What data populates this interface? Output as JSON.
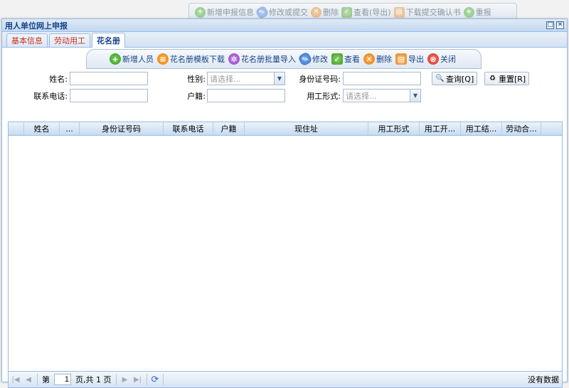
{
  "bg_toolbar": {
    "items": [
      "新增申报信息",
      "修改或提交",
      "删除",
      "查看(导出)",
      "下载提交确认书",
      "重报"
    ]
  },
  "window": {
    "title": "用人单位网上申报"
  },
  "tabs": [
    "基本信息",
    "劳动用工",
    "花名册"
  ],
  "toolbar": {
    "add": "新增人员",
    "template": "花名册模板下载",
    "import": "花名册批量导入",
    "edit": "修改",
    "view": "查看",
    "delete": "删除",
    "export": "导出",
    "close": "关闭"
  },
  "search": {
    "name_label": "姓名:",
    "gender_label": "性别:",
    "gender_placeholder": "请选择...",
    "id_label": "身份证号码:",
    "phone_label": "联系电话:",
    "huji_label": "户籍:",
    "emptype_label": "用工形式:",
    "emptype_placeholder": "请选择...",
    "query": "查询[Q]",
    "reset": "重置[R]"
  },
  "grid": {
    "columns": [
      "姓名",
      "...",
      "身份证号码",
      "联系电话",
      "户籍",
      "现住址",
      "用工形式",
      "用工开...",
      "用工结...",
      "劳动合..."
    ]
  },
  "pager": {
    "page_prefix": "第",
    "page_value": "1",
    "page_suffix": "页,共 1 页",
    "status": "没有数据"
  }
}
